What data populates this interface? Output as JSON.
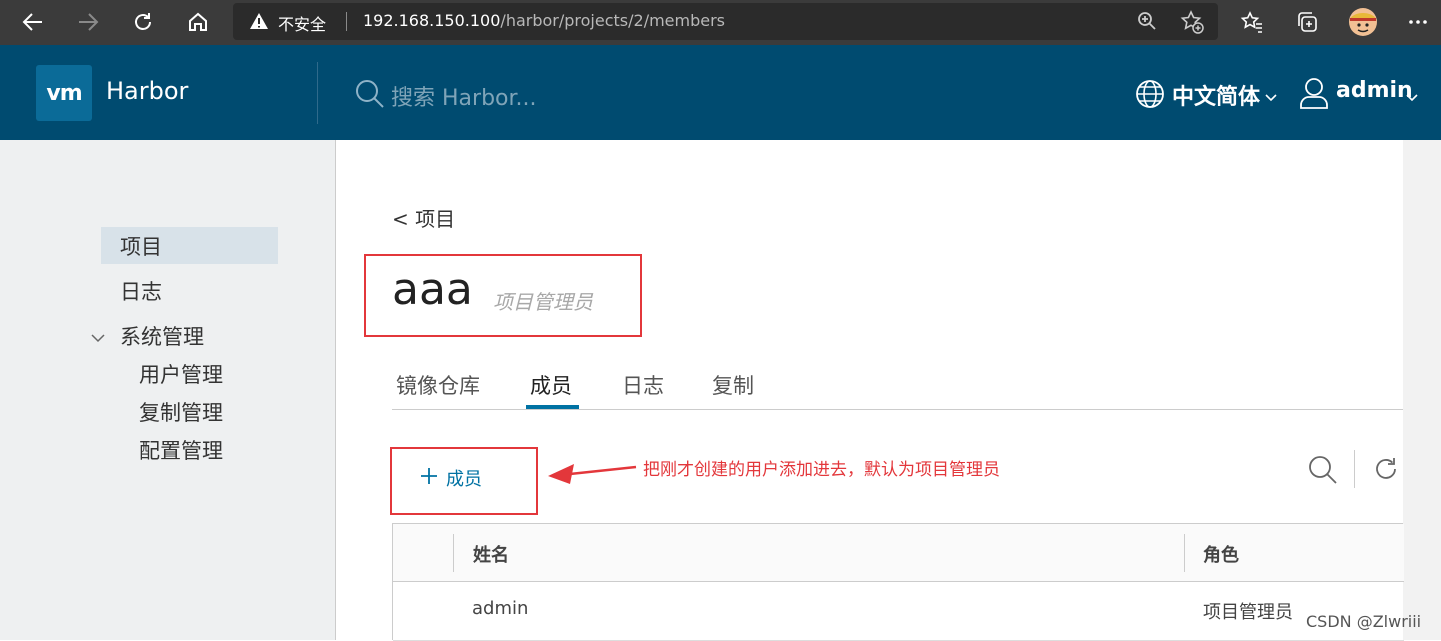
{
  "browser": {
    "insecure_label": "不安全",
    "url_host": "192.168.150.100",
    "url_path": "/harbor/projects/2/members"
  },
  "header": {
    "logo_text": "vm",
    "brand": "Harbor",
    "search_placeholder": "搜索 Harbor...",
    "language": "中文简体",
    "user": "admin"
  },
  "sidebar": {
    "items": [
      {
        "label": "项目"
      },
      {
        "label": "日志"
      },
      {
        "label": "系统管理"
      },
      {
        "label": "用户管理"
      },
      {
        "label": "复制管理"
      },
      {
        "label": "配置管理"
      }
    ]
  },
  "main": {
    "back_label": "< 项目",
    "project_name": "aaa",
    "project_role": "项目管理员",
    "tabs": [
      {
        "label": "镜像仓库"
      },
      {
        "label": "成员"
      },
      {
        "label": "日志"
      },
      {
        "label": "复制"
      }
    ],
    "add_member_label": "成员",
    "annotation": "把刚才创建的用户添加进去，默认为项目管理员",
    "table": {
      "headers": [
        "姓名",
        "角色"
      ],
      "rows": [
        {
          "name": "admin",
          "role": "项目管理员"
        }
      ]
    }
  },
  "watermark": "CSDN @Zlwriii",
  "colors": {
    "header_bg": "#004b70",
    "accent": "#0072a3",
    "highlight_red": "#e3373b"
  }
}
